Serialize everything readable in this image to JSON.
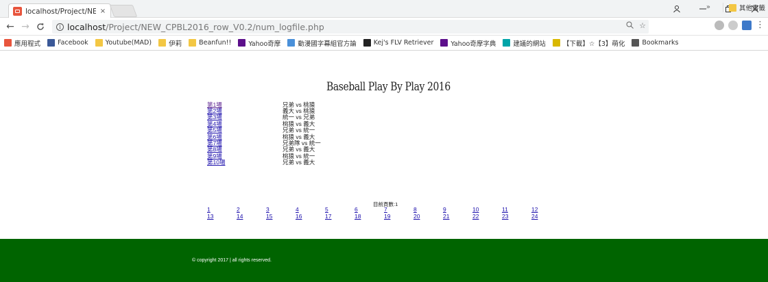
{
  "browser": {
    "tab_title": "localhost/Project/NEW",
    "tab_close": "×",
    "url_host": "localhost",
    "url_path": "/Project/NEW_CPBL2016_row_V0.2/num_logfile.php",
    "bookmarks": [
      {
        "label": "應用程式",
        "icon": "apps-grid-icon",
        "color": "#e8553d"
      },
      {
        "label": "Facebook",
        "icon": "facebook-icon",
        "color": "#3b5998"
      },
      {
        "label": "Youtube(MAD)",
        "icon": "folder-icon",
        "color": "#f3c744"
      },
      {
        "label": "伊莉",
        "icon": "folder-icon",
        "color": "#f3c744"
      },
      {
        "label": "Beanfun!!",
        "icon": "folder-icon",
        "color": "#f3c744"
      },
      {
        "label": "Yahoo奇摩",
        "icon": "yahoo-icon",
        "color": "#5c0f8b"
      },
      {
        "label": "動漫國字幕組官方論",
        "icon": "site-icon",
        "color": "#4a90d9"
      },
      {
        "label": "Kej's FLV Retriever",
        "icon": "k-icon",
        "color": "#222222"
      },
      {
        "label": "Yahoo奇摩字典",
        "icon": "yahoo-icon",
        "color": "#5c0f8b"
      },
      {
        "label": "建議的網站",
        "icon": "bing-icon",
        "color": "#00a4a8"
      },
      {
        "label": "【下載】☆【3】萌化",
        "icon": "m-icon",
        "color": "#d9b800"
      },
      {
        "label": "Bookmarks",
        "icon": "star-icon",
        "color": "#555555"
      }
    ],
    "other_bookmarks": "其他書籤",
    "more_bookmarks": "»"
  },
  "page": {
    "logo_text": "Baseball Play By Play 2016",
    "games": [
      {
        "label": "第1場",
        "match": "兄弟 vs 桃猿",
        "visited": true
      },
      {
        "label": "第2場",
        "match": "義大 vs 桃猿",
        "visited": false
      },
      {
        "label": "第3場",
        "match": "統一 vs 兄弟",
        "visited": false
      },
      {
        "label": "第4場",
        "match": "桃猿 vs 義大",
        "visited": false
      },
      {
        "label": "第5場",
        "match": "兄弟 vs 統一",
        "visited": false
      },
      {
        "label": "第6場",
        "match": "桃猿 vs 義大",
        "visited": false
      },
      {
        "label": "第7場",
        "match": "兄弟隊 vs 統一",
        "visited": false
      },
      {
        "label": "第8場",
        "match": "兄弟 vs 義大",
        "visited": false
      },
      {
        "label": "第9場",
        "match": "桃猿 vs 統一",
        "visited": false
      },
      {
        "label": "第10場",
        "match": "兄弟 vs 義大",
        "visited": false
      }
    ],
    "pager_label": "目前頁數:1",
    "pages": [
      "1",
      "2",
      "3",
      "4",
      "5",
      "6",
      "7",
      "8",
      "9",
      "10",
      "11",
      "12",
      "13",
      "14",
      "15",
      "16",
      "17",
      "18",
      "19",
      "20",
      "21",
      "22",
      "23",
      "24"
    ],
    "footer": "© copyright 2017 | all rights reserved."
  }
}
